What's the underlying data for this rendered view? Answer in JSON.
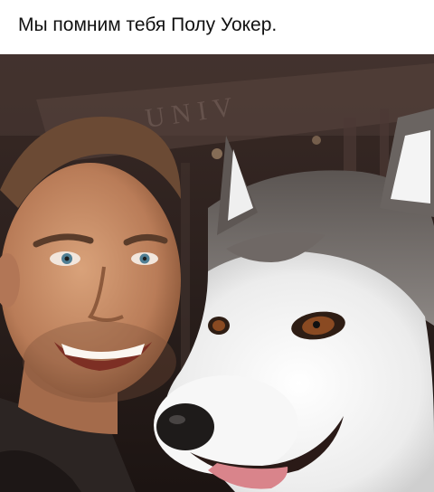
{
  "post": {
    "caption": "Мы помним тебя Полу Уокер.",
    "photo_description_icon": "photo-man-with-husky",
    "colors": {
      "caption_text": "#111111",
      "background": "#ffffff"
    }
  }
}
